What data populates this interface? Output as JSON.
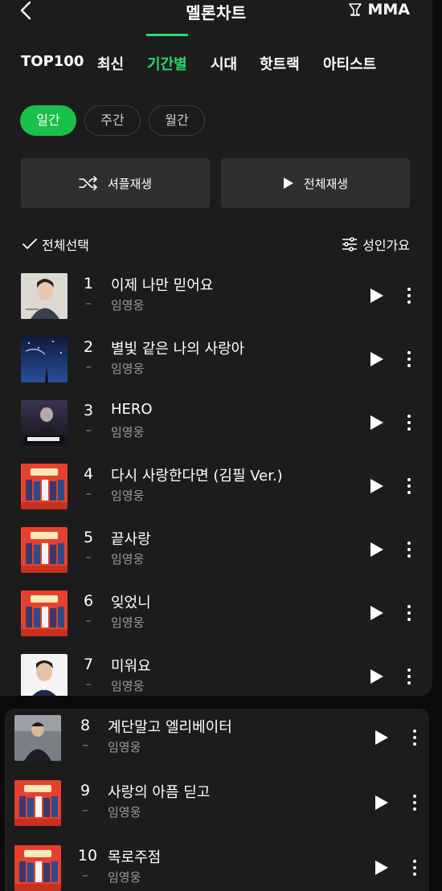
{
  "header": {
    "title": "멜론차트",
    "award_label": "MMA"
  },
  "tabs": [
    {
      "label": "TOP100",
      "active": false
    },
    {
      "label": "최신",
      "active": false
    },
    {
      "label": "기간별",
      "active": true
    },
    {
      "label": "시대",
      "active": false
    },
    {
      "label": "핫트랙",
      "active": false
    },
    {
      "label": "아티스트",
      "active": false
    }
  ],
  "period": {
    "daily": "일간",
    "weekly": "주간",
    "monthly": "월간",
    "selected": "일간"
  },
  "actions": {
    "shuffle": "셔플재생",
    "play_all": "전체재생"
  },
  "list_toolbar": {
    "select_all": "전체선택",
    "adult_filter": "성인가요"
  },
  "songs": [
    {
      "rank": "1",
      "change": "–",
      "title": "이제 나만 믿어요",
      "artist": "임영웅"
    },
    {
      "rank": "2",
      "change": "–",
      "title": "별빛 같은 나의 사랑아",
      "artist": "임영웅"
    },
    {
      "rank": "3",
      "change": "–",
      "title": "HERO",
      "artist": "임영웅"
    },
    {
      "rank": "4",
      "change": "–",
      "title": "다시 사랑한다면 (김필 Ver.)",
      "artist": "임영웅"
    },
    {
      "rank": "5",
      "change": "–",
      "title": "끝사랑",
      "artist": "임영웅"
    },
    {
      "rank": "6",
      "change": "–",
      "title": "잊었니",
      "artist": "임영웅"
    },
    {
      "rank": "7",
      "change": "–",
      "title": "미워요",
      "artist": "임영웅"
    },
    {
      "rank": "8",
      "change": "–",
      "title": "계단말고 엘리베이터",
      "artist": "임영웅"
    },
    {
      "rank": "9",
      "change": "–",
      "title": "사랑의 아픔 딛고",
      "artist": "임영웅"
    },
    {
      "rank": "10",
      "change": "–",
      "title": "목로주점",
      "artist": "임영웅"
    }
  ],
  "colors": {
    "accent_green": "#2bd96b",
    "pill_green": "#19c04a",
    "background": "#1c1c1d",
    "button_bg": "#2f2f31"
  }
}
